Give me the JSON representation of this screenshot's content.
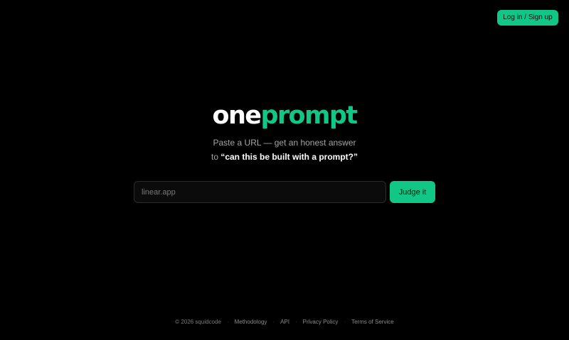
{
  "header": {
    "login_label": "Log in / Sign up"
  },
  "hero": {
    "brand_part1": "one",
    "brand_part2": "prompt",
    "tagline_line1": "Paste a URL — get an honest answer",
    "tagline_prefix": "to ",
    "tagline_strong": "“can this be built with a prompt?”"
  },
  "search": {
    "placeholder": "linear.app",
    "value": "",
    "button_label": "Judge it"
  },
  "footer": {
    "copyright": "© 2026 squidcode",
    "separator": "·",
    "links": [
      {
        "label": "Methodology"
      },
      {
        "label": "API"
      },
      {
        "label": "Privacy Policy"
      },
      {
        "label": "Terms of Service"
      }
    ]
  },
  "colors": {
    "accent": "#10c785",
    "background": "#000000",
    "brand_white": "#ffffff"
  }
}
